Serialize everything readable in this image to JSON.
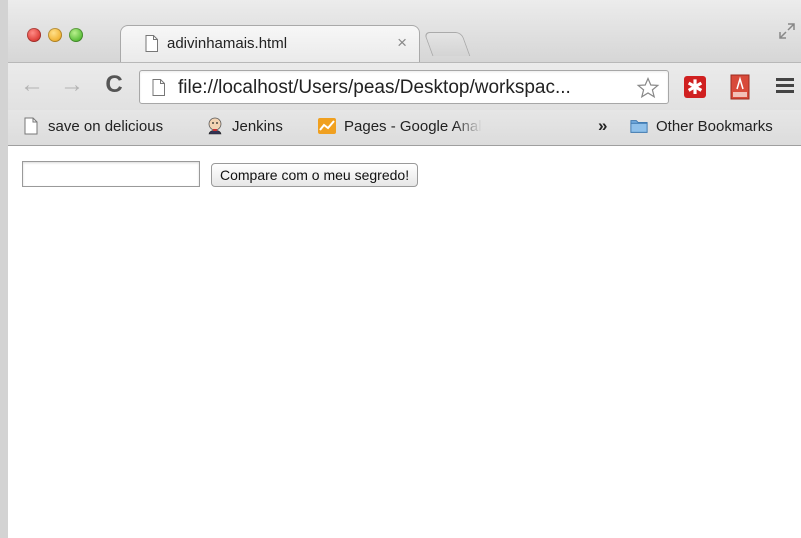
{
  "tab": {
    "title": "adivinhamais.html",
    "close_glyph": "×"
  },
  "toolbar": {
    "back_glyph": "←",
    "forward_glyph": "→",
    "reload_glyph": "C",
    "url": "file://localhost/Users/peas/Desktop/workspac...",
    "lastpass_glyph": "✱"
  },
  "bookmarks": {
    "items": [
      {
        "label": "save on delicious",
        "icon": "page-icon"
      },
      {
        "label": "Jenkins",
        "icon": "jenkins-icon"
      },
      {
        "label": "Pages - Google Anal",
        "icon": "analytics-icon"
      }
    ],
    "overflow_glyph": "»",
    "other_label": "Other Bookmarks"
  },
  "page": {
    "input_value": "",
    "button_label": "Compare com o meu segredo!"
  },
  "colors": {
    "lastpass_red": "#d02020",
    "analytics_orange": "#f0a020",
    "folder_blue": "#6fa8dc"
  }
}
